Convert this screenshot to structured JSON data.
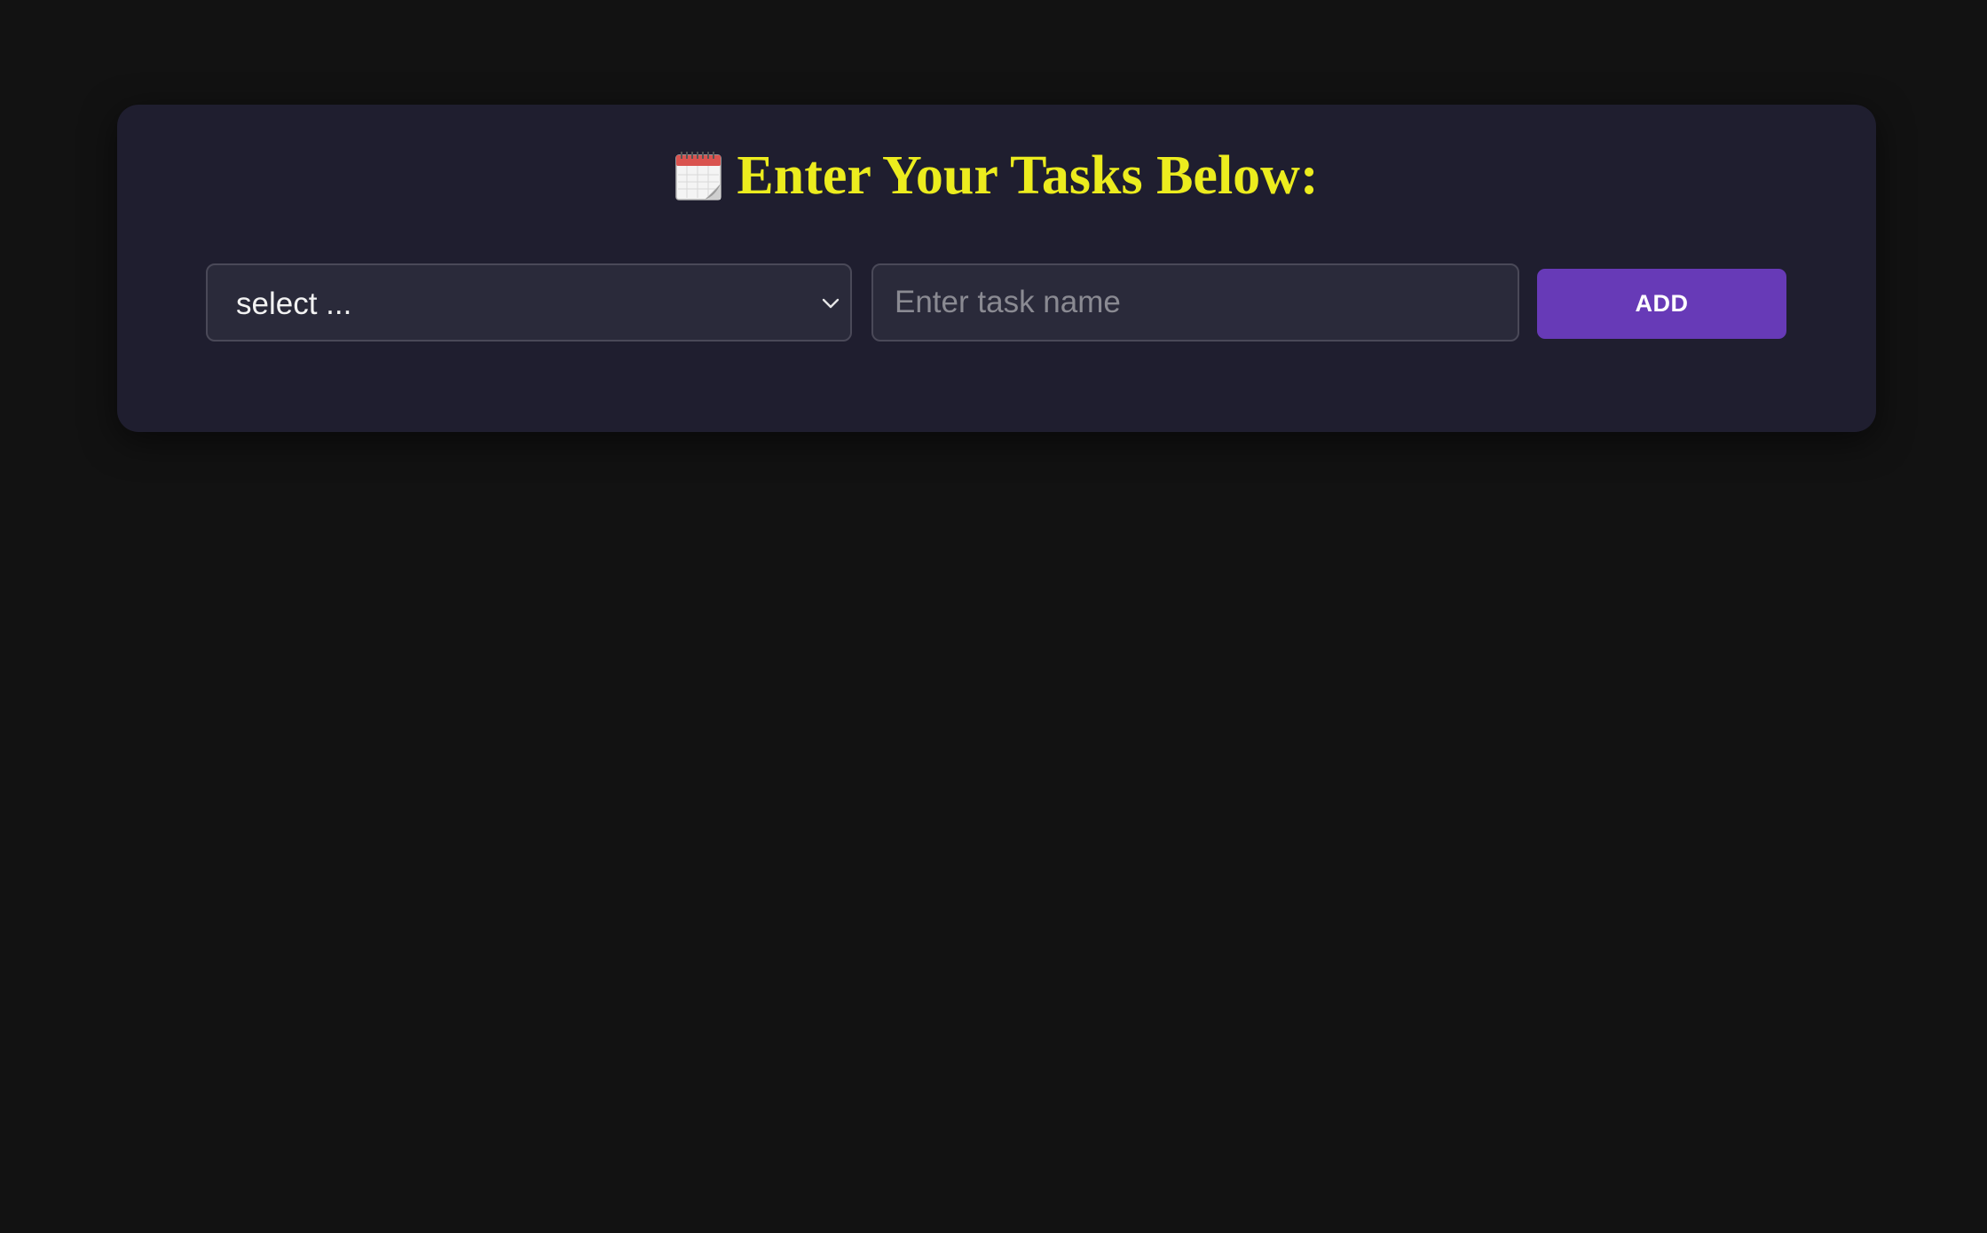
{
  "header": {
    "icon": "spiral-calendar-icon",
    "title": "Enter Your Tasks Below:"
  },
  "form": {
    "select": {
      "selected": "select ..."
    },
    "task_input": {
      "value": "",
      "placeholder": "Enter task name"
    },
    "add_label": "ADD"
  },
  "colors": {
    "page_background": "#121212",
    "card_background": "#1f1e2f",
    "title": "#ecec1e",
    "accent_button": "#673ab7",
    "field_background": "#2a2a3a",
    "field_border": "#4a4958"
  }
}
